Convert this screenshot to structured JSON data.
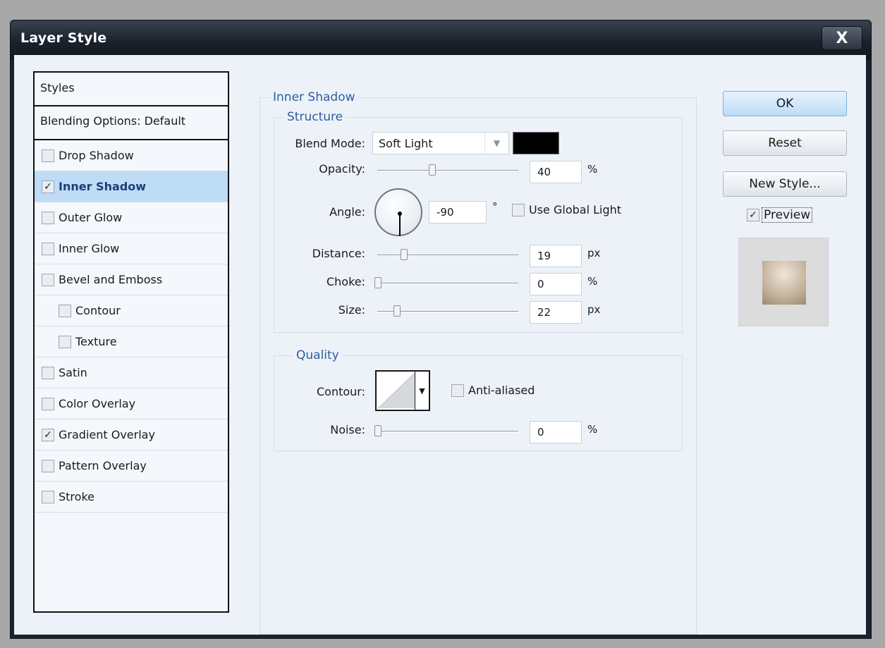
{
  "window": {
    "title": "Layer Style",
    "close_label": "X"
  },
  "styles_panel": {
    "header": "Styles",
    "blending_options": "Blending Options: Default",
    "items": [
      {
        "label": "Drop Shadow",
        "checked": false,
        "active": false,
        "sub": false
      },
      {
        "label": "Inner Shadow",
        "checked": true,
        "active": true,
        "sub": false
      },
      {
        "label": "Outer Glow",
        "checked": false,
        "active": false,
        "sub": false
      },
      {
        "label": "Inner Glow",
        "checked": false,
        "active": false,
        "sub": false
      },
      {
        "label": "Bevel and Emboss",
        "checked": false,
        "active": false,
        "sub": false
      },
      {
        "label": "Contour",
        "checked": false,
        "active": false,
        "sub": true
      },
      {
        "label": "Texture",
        "checked": false,
        "active": false,
        "sub": true
      },
      {
        "label": "Satin",
        "checked": false,
        "active": false,
        "sub": false
      },
      {
        "label": "Color Overlay",
        "checked": false,
        "active": false,
        "sub": false
      },
      {
        "label": "Gradient Overlay",
        "checked": true,
        "active": false,
        "sub": false
      },
      {
        "label": "Pattern Overlay",
        "checked": false,
        "active": false,
        "sub": false
      },
      {
        "label": "Stroke",
        "checked": false,
        "active": false,
        "sub": false
      }
    ]
  },
  "inner_shadow": {
    "group_title": "Inner Shadow",
    "structure": {
      "title": "Structure",
      "blend_mode_label": "Blend Mode:",
      "blend_mode_value": "Soft Light",
      "shadow_color": "#000000",
      "opacity_label": "Opacity:",
      "opacity_value": "40",
      "opacity_unit": "%",
      "angle_label": "Angle:",
      "angle_value": "-90",
      "angle_unit": "°",
      "use_global_light_label": "Use Global Light",
      "use_global_light_checked": false,
      "distance_label": "Distance:",
      "distance_value": "19",
      "distance_unit": "px",
      "choke_label": "Choke:",
      "choke_value": "0",
      "choke_unit": "%",
      "size_label": "Size:",
      "size_value": "22",
      "size_unit": "px"
    },
    "quality": {
      "title": "Quality",
      "contour_label": "Contour:",
      "anti_aliased_label": "Anti-aliased",
      "anti_aliased_checked": false,
      "noise_label": "Noise:",
      "noise_value": "0",
      "noise_unit": "%"
    }
  },
  "buttons": {
    "ok": "OK",
    "reset": "Reset",
    "new_style": "New Style...",
    "preview_label": "Preview",
    "preview_checked": true
  }
}
